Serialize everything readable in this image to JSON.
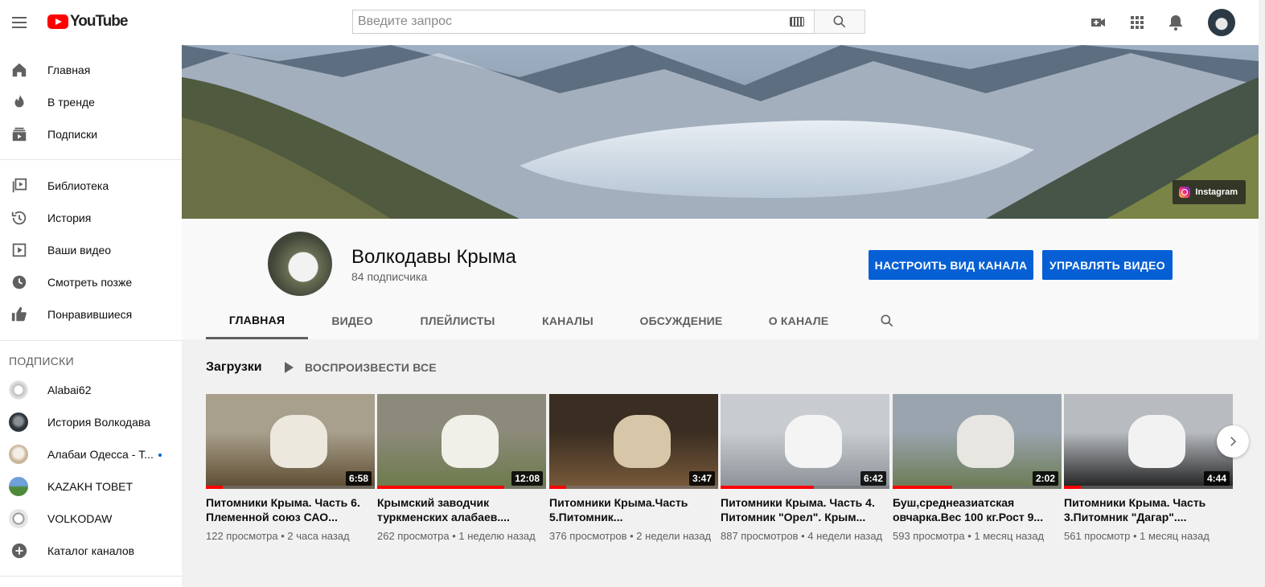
{
  "masthead": {
    "logo_text": "YouTube",
    "search_placeholder": "Введите запрос"
  },
  "sidebar": {
    "main": [
      {
        "label": "Главная",
        "icon": "home-icon"
      },
      {
        "label": "В тренде",
        "icon": "trending-icon"
      },
      {
        "label": "Подписки",
        "icon": "subscriptions-icon"
      }
    ],
    "library": [
      {
        "label": "Библиотека",
        "icon": "library-icon"
      },
      {
        "label": "История",
        "icon": "history-icon"
      },
      {
        "label": "Ваши видео",
        "icon": "your-videos-icon"
      },
      {
        "label": "Смотреть позже",
        "icon": "watch-later-icon"
      },
      {
        "label": "Понравившиеся",
        "icon": "liked-icon"
      }
    ],
    "subscriptions_heading": "ПОДПИСКИ",
    "subscriptions": [
      {
        "label": "Alabai62",
        "color": "#d9d9d9"
      },
      {
        "label": "История Волкодава",
        "color": "#3b4450"
      },
      {
        "label": "Алабаи Одесса - Т...",
        "color": "#c9b59a",
        "new": true
      },
      {
        "label": "KAZAKH TOBET",
        "color": "#5a7fb0"
      },
      {
        "label": "VOLKODAW",
        "color": "#e0e0e0"
      },
      {
        "label": "Каталог каналов",
        "icon": "add-circle-icon"
      }
    ]
  },
  "banner": {
    "link_label": "Instagram"
  },
  "channel": {
    "name": "Волкодавы Крыма",
    "subscribers": "84 подписчика",
    "customize_button": "НАСТРОИТЬ ВИД КАНАЛА",
    "manage_button": "УПРАВЛЯТЬ ВИДЕО",
    "tabs": [
      "ГЛАВНАЯ",
      "ВИДЕО",
      "ПЛЕЙЛИСТЫ",
      "КАНАЛЫ",
      "ОБСУЖДЕНИЕ",
      "О КАНАЛЕ"
    ],
    "active_tab": "ГЛАВНАЯ"
  },
  "shelf": {
    "title": "Загрузки",
    "play_all": "ВОСПРОИЗВЕСТИ ВСЕ",
    "videos": [
      {
        "title": "Питомники Крыма. Часть 6. Племенной союз САО...",
        "views": "122 просмотра",
        "age": "2 часа назад",
        "duration": "6:58",
        "watched": 0.1,
        "colors": [
          "#a8a08c",
          "#5c4a30",
          "#ece8de"
        ]
      },
      {
        "title": "Крымский заводчик туркменских алабаев....",
        "views": "262 просмотра",
        "age": "1 неделю назад",
        "duration": "12:08",
        "watched": 0.75,
        "colors": [
          "#8c8a7a",
          "#6b7a4a",
          "#f0efe8"
        ]
      },
      {
        "title": "Питомники Крыма.Часть 5.Питомник...",
        "views": "376 просмотров",
        "age": "2 недели назад",
        "duration": "3:47",
        "watched": 0.1,
        "colors": [
          "#3a2e22",
          "#7a5a3a",
          "#d8c6a8"
        ]
      },
      {
        "title": "Питомники Крыма. Часть 4. Питомник \"Орел\". Крым...",
        "views": "887 просмотров",
        "age": "4 недели назад",
        "duration": "6:42",
        "watched": 0.55,
        "colors": [
          "#c8ccd0",
          "#8a9096",
          "#f4f4f4"
        ]
      },
      {
        "title": "Буш,среднеазиатская овчарка.Вес 100 кг.Рост 9...",
        "views": "593 просмотра",
        "age": "1 месяц назад",
        "duration": "2:02",
        "watched": 0.35,
        "colors": [
          "#9aa4ae",
          "#6a7a52",
          "#e8e6e0"
        ]
      },
      {
        "title": "Питомники Крыма. Часть 3.Питомник \"Дагар\"....",
        "views": "561 просмотр",
        "age": "1 месяц назад",
        "duration": "4:44",
        "watched": 0.1,
        "colors": [
          "#b8bcc0",
          "#1e1e1e",
          "#f2f2f2"
        ]
      }
    ]
  }
}
